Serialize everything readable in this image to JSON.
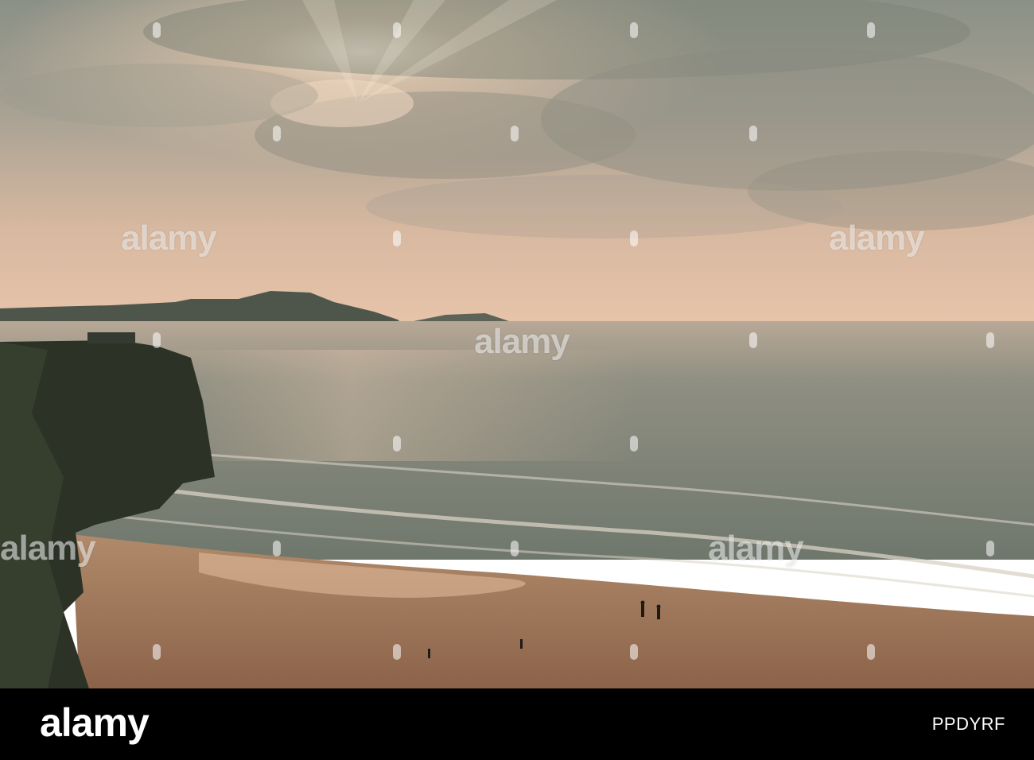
{
  "photo": {
    "subject": "sunset over a bay with a sandy beach, sea cliffs and a headland town",
    "colors": {
      "sky_top": "#8f9488",
      "sky_glow": "#f2c9a8",
      "horizon": "#d9b49a",
      "sea": "#7d8276",
      "sand": "#a97c5c",
      "cliff": "#2c3226"
    }
  },
  "watermark": {
    "text": "alamy"
  },
  "footer": {
    "logo": "alamy",
    "image_id": "PPDYRF"
  }
}
